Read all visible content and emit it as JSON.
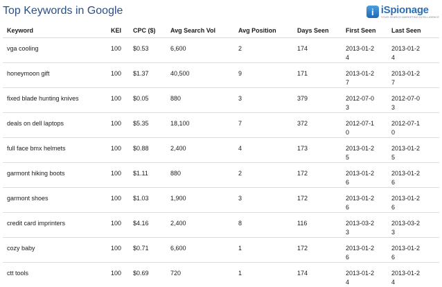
{
  "header": {
    "title": "Top Keywords in Google",
    "brand_name": "iSpionage",
    "brand_tagline": "YOUR SEARCH MARKETING INTELLIGENCE"
  },
  "table": {
    "columns": [
      "Keyword",
      "KEI",
      "CPC ($)",
      "Avg Search Vol",
      "Avg Position",
      "Days Seen",
      "First Seen",
      "Last Seen"
    ],
    "rows": [
      [
        "vga cooling",
        "100",
        "$0.53",
        "6,600",
        "2",
        "174",
        "2013-01-24",
        "2013-01-24"
      ],
      [
        "honeymoon gift",
        "100",
        "$1.37",
        "40,500",
        "9",
        "171",
        "2013-01-27",
        "2013-01-27"
      ],
      [
        "fixed blade hunting knives",
        "100",
        "$0.05",
        "880",
        "3",
        "379",
        "2012-07-03",
        "2012-07-03"
      ],
      [
        "deals on dell laptops",
        "100",
        "$5.35",
        "18,100",
        "7",
        "372",
        "2012-07-10",
        "2012-07-10"
      ],
      [
        "full face bmx helmets",
        "100",
        "$0.88",
        "2,400",
        "4",
        "173",
        "2013-01-25",
        "2013-01-25"
      ],
      [
        "garmont hiking boots",
        "100",
        "$1.11",
        "880",
        "2",
        "172",
        "2013-01-26",
        "2013-01-26"
      ],
      [
        "garmont shoes",
        "100",
        "$1.03",
        "1,900",
        "3",
        "172",
        "2013-01-26",
        "2013-01-26"
      ],
      [
        "credit card imprinters",
        "100",
        "$4.16",
        "2,400",
        "8",
        "116",
        "2013-03-23",
        "2013-03-23"
      ],
      [
        "cozy baby",
        "100",
        "$0.71",
        "6,600",
        "1",
        "172",
        "2013-01-26",
        "2013-01-26"
      ],
      [
        "ctt tools",
        "100",
        "$0.69",
        "720",
        "1",
        "174",
        "2013-01-24",
        "2013-01-24"
      ]
    ]
  }
}
